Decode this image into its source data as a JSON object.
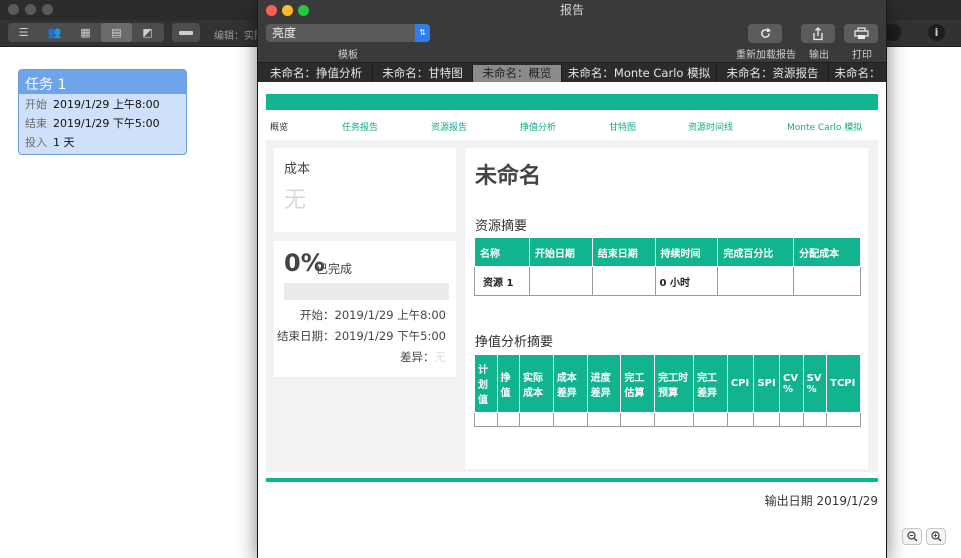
{
  "background_app": {
    "edit_label": "编辑：实际",
    "task_card": {
      "title": "任务 1",
      "rows": [
        {
          "key": "开始",
          "value": "2019/1/29 上午8:00"
        },
        {
          "key": "结束",
          "value": "2019/1/29 下午5:00"
        },
        {
          "key": "投入",
          "value": "1 天"
        }
      ]
    }
  },
  "report_window": {
    "title": "报告",
    "template_select": {
      "value": "亮度",
      "label": "模板"
    },
    "toolbar": {
      "reload_label": "重新加载报告",
      "export_label": "输出",
      "print_label": "打印"
    },
    "tabs": [
      {
        "label": "未命名：挣值分析",
        "active": false
      },
      {
        "label": "未命名：甘特图",
        "active": false
      },
      {
        "label": "未命名：概览",
        "active": true
      },
      {
        "label": "未命名：Monte Carlo 模拟",
        "active": false
      },
      {
        "label": "未命名：资源报告",
        "active": false
      },
      {
        "label": "未命名：",
        "active": false
      }
    ]
  },
  "report": {
    "nav": [
      "概览",
      "任务报告",
      "资源报告",
      "挣值分析",
      "甘特图",
      "资源时间线",
      "Monte Carlo 模拟"
    ],
    "cost": {
      "label": "成本",
      "value": "无"
    },
    "progress": {
      "percent": "0%",
      "percent_suffix": "已完成",
      "start": "开始：2019/1/29 上午8:00",
      "end": "结束日期：2019/1/29 下午5:00",
      "variance_label": "差异：",
      "variance_value": "无"
    },
    "project_title": "未命名",
    "resource_summary": {
      "title": "资源摘要",
      "headers": [
        "名称",
        "开始日期",
        "结束日期",
        "持续时间",
        "完成百分比",
        "分配成本"
      ],
      "rows": [
        [
          "资源 1",
          "",
          "",
          "0 小时",
          "",
          ""
        ]
      ]
    },
    "ev_summary": {
      "title": "挣值分析摘要",
      "headers": [
        "计划值",
        "挣值",
        "实际成本",
        "成本差异",
        "进度差异",
        "完工估算",
        "完工时预算",
        "完工差异",
        "CPI",
        "SPI",
        "CV %",
        "SV %",
        "TCPI"
      ]
    },
    "export_date": "输出日期 2019/1/29"
  },
  "colors": {
    "accent": "#12b48f",
    "task_header": "#6ea5ea",
    "task_body": "#cfe0fa"
  }
}
